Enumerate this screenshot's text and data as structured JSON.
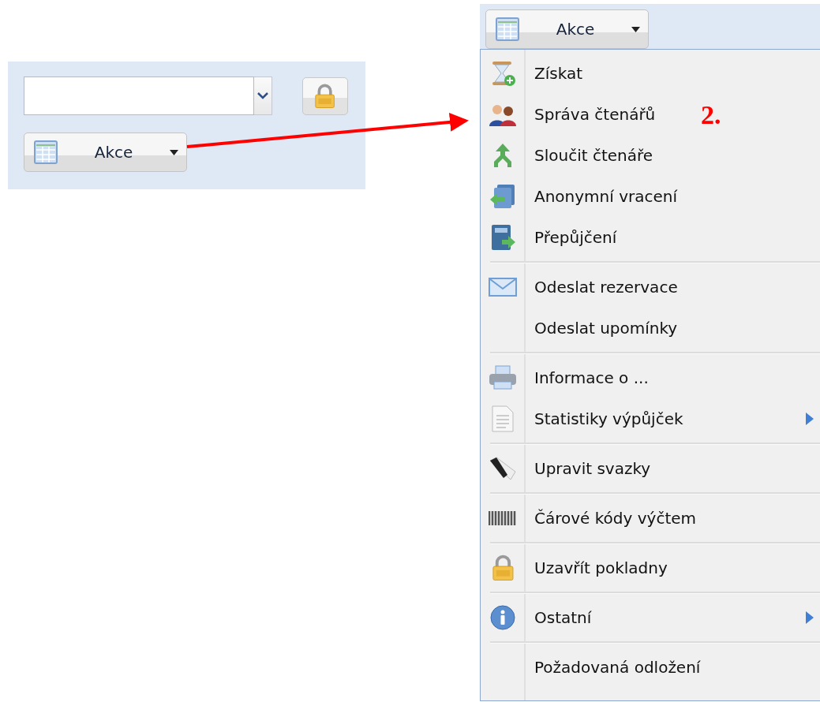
{
  "left_panel": {
    "action_button": {
      "label": "Akce"
    }
  },
  "menu_panel": {
    "action_button": {
      "label": "Akce"
    },
    "menu": {
      "groups": [
        [
          {
            "label": "Získat",
            "submenu": false
          },
          {
            "label": "Správa čtenářů",
            "submenu": false
          },
          {
            "label": "Sloučit čtenáře",
            "submenu": false
          },
          {
            "label": "Anonymní vracení",
            "submenu": false
          },
          {
            "label": "Přepůjčení",
            "submenu": false
          }
        ],
        [
          {
            "label": "Odeslat rezervace",
            "submenu": false
          },
          {
            "label": "Odeslat upomínky",
            "submenu": false
          }
        ],
        [
          {
            "label": "Informace o ...",
            "submenu": false
          },
          {
            "label": "Statistiky výpůjček",
            "submenu": true
          }
        ],
        [
          {
            "label": "Upravit svazky",
            "submenu": false
          }
        ],
        [
          {
            "label": "Čárové kódy výčtem",
            "submenu": false
          }
        ],
        [
          {
            "label": "Uzavřít pokladny",
            "submenu": false
          }
        ],
        [
          {
            "label": "Ostatní",
            "submenu": true
          }
        ],
        [
          {
            "label": "Požadovaná odložení",
            "submenu": false
          }
        ]
      ]
    }
  },
  "annotation": {
    "label": "2."
  }
}
